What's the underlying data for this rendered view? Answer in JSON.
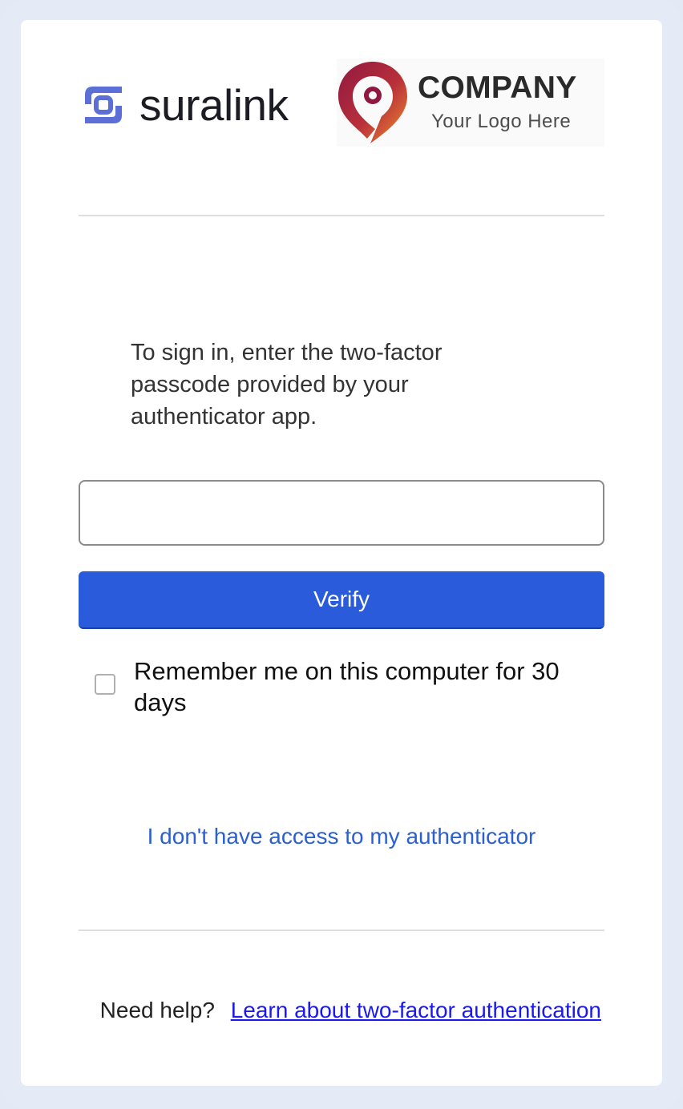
{
  "logos": {
    "suralink_word": "suralink",
    "suralink_mark_icon": "suralink-mark-icon",
    "company_name": "COMPANY",
    "company_tagline": "Your Logo Here",
    "company_pin_icon": "map-pin-icon"
  },
  "colors": {
    "accent": "#295bda",
    "link": "#2c5fcf",
    "help_link": "#1a1aee",
    "suralink_mark": "#5b6fd6",
    "pin_dark": "#9b1b3e",
    "pin_light": "#e8822c"
  },
  "main": {
    "instructions": "To sign in, enter the two-factor passcode provided by your authenticator app.",
    "passcode_input": {
      "value": "",
      "placeholder": ""
    },
    "verify_label": "Verify",
    "remember": {
      "checked": false,
      "label": "Remember me on this computer for 30 days"
    },
    "no_access_link": "I don't have access to my authenticator"
  },
  "footer": {
    "help_prefix": "Need help?",
    "help_link": "Learn about two-factor authentication"
  }
}
